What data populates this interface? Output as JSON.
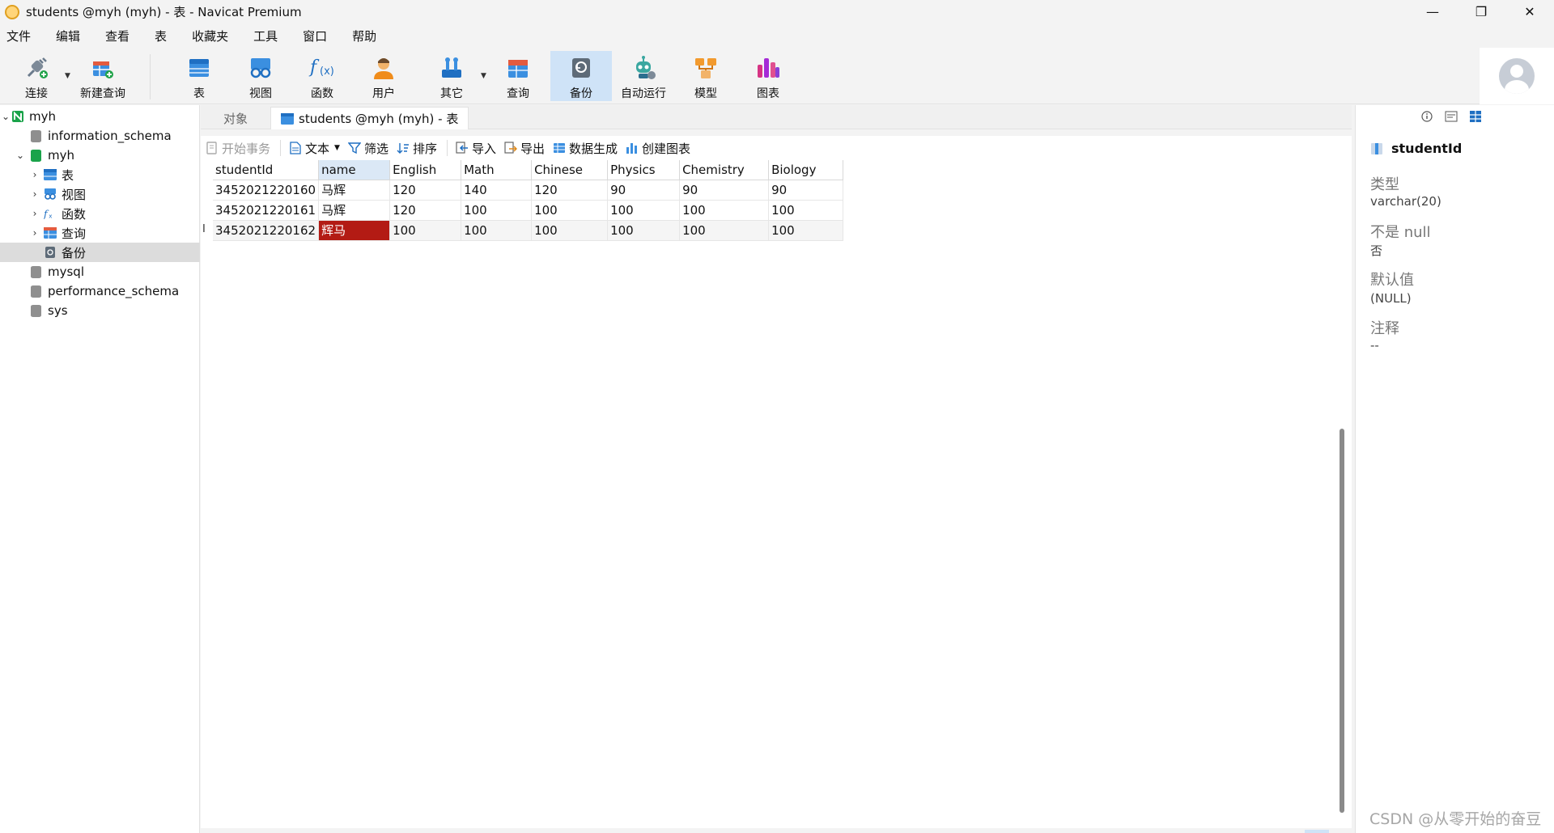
{
  "window": {
    "title": "students @myh (myh) - 表 - Navicat Premium",
    "controls": [
      "—",
      "❐",
      "✕"
    ]
  },
  "menu": [
    "文件",
    "编辑",
    "查看",
    "表",
    "收藏夹",
    "工具",
    "窗口",
    "帮助"
  ],
  "toolbar": {
    "connect": "连接",
    "new_query": "新建查询",
    "table": "表",
    "view": "视图",
    "function": "函数",
    "user": "用户",
    "other": "其它",
    "query": "查询",
    "backup": "备份",
    "automation": "自动运行",
    "model": "模型",
    "chart": "图表"
  },
  "tree": {
    "root": "myh",
    "items": [
      {
        "label": "information_schema"
      },
      {
        "label": "myh"
      },
      {
        "label": "表"
      },
      {
        "label": "视图"
      },
      {
        "label": "函数"
      },
      {
        "label": "查询"
      },
      {
        "label": "备份"
      },
      {
        "label": "mysql"
      },
      {
        "label": "performance_schema"
      },
      {
        "label": "sys"
      }
    ]
  },
  "tabs": {
    "objects": "对象",
    "students": "students @myh (myh) - 表"
  },
  "subtoolbar": {
    "begin_txn": "开始事务",
    "text": "文本",
    "filter": "筛选",
    "sort": "排序",
    "import": "导入",
    "export": "导出",
    "data_gen": "数据生成",
    "create_chart": "创建图表"
  },
  "grid": {
    "columns": [
      "studentId",
      "name",
      "English",
      "Math",
      "Chinese",
      "Physics",
      "Chemistry",
      "Biology"
    ],
    "rows": [
      [
        "3452021220160",
        "马辉",
        "120",
        "140",
        "120",
        "90",
        "90",
        "90"
      ],
      [
        "3452021220161",
        "马辉",
        "120",
        "100",
        "100",
        "100",
        "100",
        "100"
      ],
      [
        "3452021220162",
        "辉马",
        "100",
        "100",
        "100",
        "100",
        "100",
        "100"
      ]
    ],
    "current_row_indicator": "I"
  },
  "inspector": {
    "field": "studentId",
    "type_label": "类型",
    "type_value": "varchar(20)",
    "notnull_label": "不是 null",
    "notnull_value": "否",
    "default_label": "默认值",
    "default_value": "(NULL)",
    "comment_label": "注释",
    "comment_value": "--"
  },
  "watermark": "CSDN @从零开始的奋豆",
  "colors": {
    "accent": "#1c7ed6",
    "active_tool": "#cfe3f7",
    "edit_cell": "#b31b14"
  }
}
